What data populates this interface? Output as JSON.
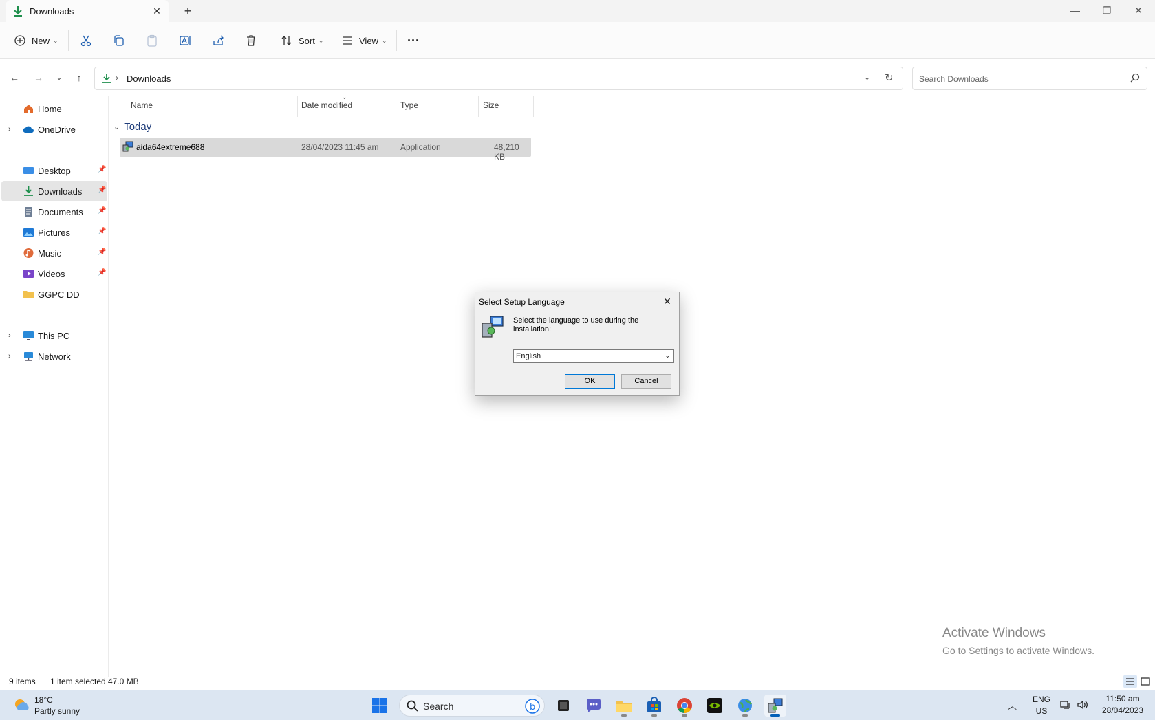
{
  "window": {
    "tab_title": "Downloads",
    "new_tab": "+",
    "minimize": "—",
    "maximize": "❐",
    "close": "✕"
  },
  "toolbar": {
    "new_label": "New",
    "sort_label": "Sort",
    "view_label": "View",
    "more_label": "···"
  },
  "address": {
    "path": "Downloads",
    "search_placeholder": "Search Downloads"
  },
  "sidebar": {
    "items": [
      {
        "label": "Home"
      },
      {
        "label": "OneDrive"
      },
      {
        "label": "Desktop"
      },
      {
        "label": "Downloads"
      },
      {
        "label": "Documents"
      },
      {
        "label": "Pictures"
      },
      {
        "label": "Music"
      },
      {
        "label": "Videos"
      },
      {
        "label": "GGPC DD"
      },
      {
        "label": "This PC"
      },
      {
        "label": "Network"
      }
    ]
  },
  "filelist": {
    "columns": [
      "Name",
      "Date modified",
      "Type",
      "Size"
    ],
    "group": "Today",
    "rows": [
      {
        "name": "aida64extreme688",
        "date": "28/04/2023 11:45 am",
        "type": "Application",
        "size": "48,210 KB"
      }
    ]
  },
  "dialog": {
    "title": "Select Setup Language",
    "message": "Select the language to use during the installation:",
    "selected_language": "English",
    "ok_label": "OK",
    "cancel_label": "Cancel"
  },
  "watermark": {
    "line1": "Activate Windows",
    "line2": "Go to Settings to activate Windows."
  },
  "status": {
    "items_count": "9 items",
    "selection": "1 item selected",
    "selection_size": "47.0 MB"
  },
  "taskbar": {
    "weather_temp": "18°C",
    "weather_cond": "Partly sunny",
    "search_label": "Search",
    "lang_line1": "ENG",
    "lang_line2": "US",
    "time": "11:50 am",
    "date": "28/04/2023"
  },
  "colors": {
    "accent": "#005fb8",
    "download_green": "#1f8f4d",
    "selection_gray": "#d9d9d9"
  }
}
